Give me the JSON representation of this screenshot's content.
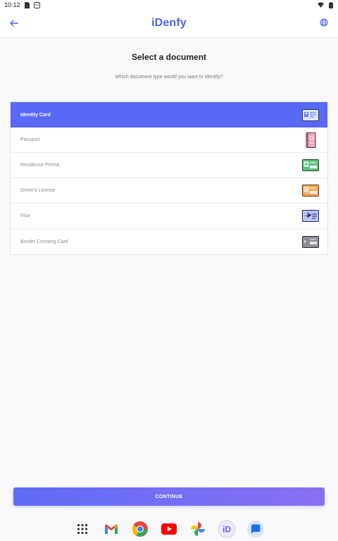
{
  "status_bar": {
    "time": "10:12"
  },
  "app_bar": {
    "logo": "iDenfy"
  },
  "page": {
    "title": "Select a document",
    "subtitle": "Which document type would you want to identify?"
  },
  "documents": [
    {
      "label": "Identity Card",
      "icon": "identity-card-icon",
      "selected": true
    },
    {
      "label": "Passport",
      "icon": "passport-icon",
      "selected": false
    },
    {
      "label": "Residence Permit",
      "icon": "residence-permit-icon",
      "selected": false
    },
    {
      "label": "Driver's License",
      "icon": "drivers-license-icon",
      "selected": false
    },
    {
      "label": "Visa",
      "icon": "visa-icon",
      "selected": false
    },
    {
      "label": "Border Crossing Card",
      "icon": "border-crossing-card-icon",
      "selected": false
    }
  ],
  "continue_button": {
    "label": "CONTINUE"
  },
  "dock": {
    "apps": [
      "app-drawer-icon",
      "gmail-icon",
      "chrome-icon",
      "youtube-icon",
      "photos-icon",
      "idenfy-app-icon",
      "messages-icon"
    ]
  },
  "colors": {
    "accent": "#5869f5",
    "logo": "#4a64f2",
    "button_gradient_start": "#5e6cf6",
    "button_gradient_end": "#8a6ff2"
  }
}
